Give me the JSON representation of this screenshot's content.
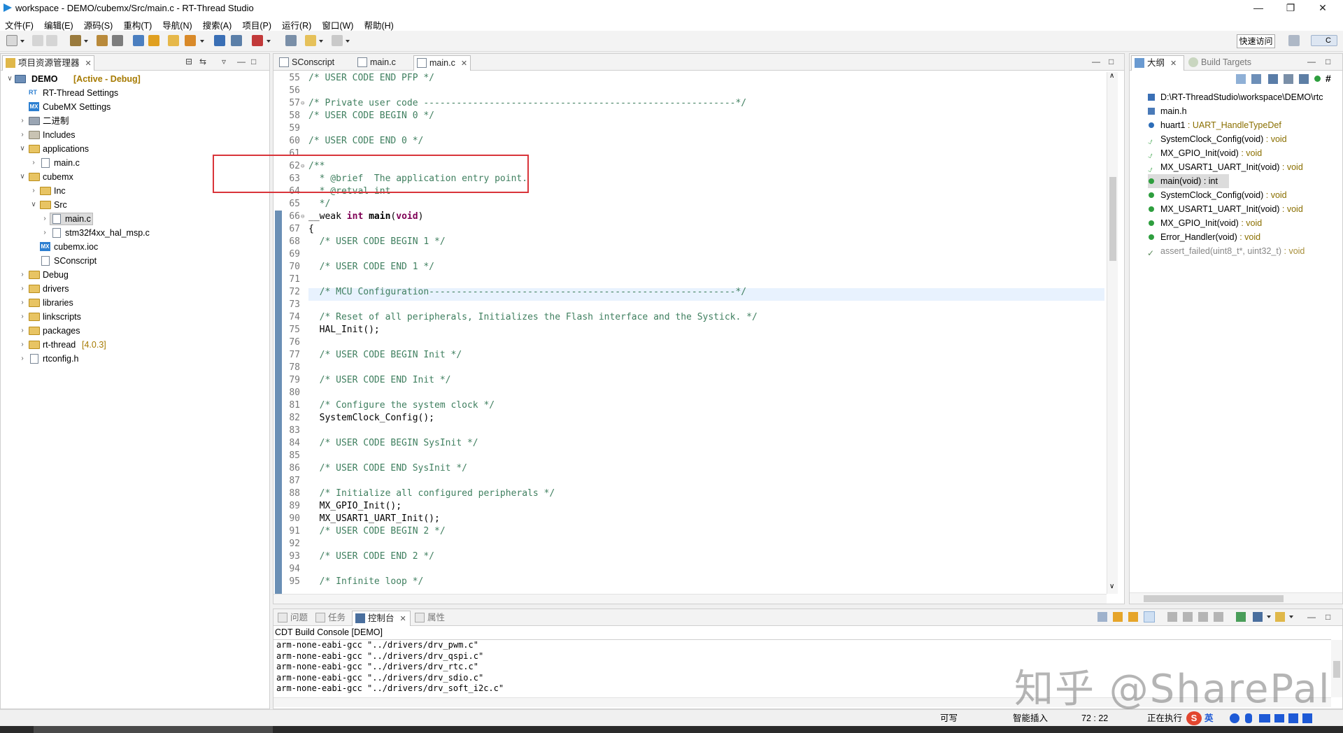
{
  "window": {
    "title": "workspace - DEMO/cubemx/Src/main.c - RT-Thread Studio",
    "min_icon": "minimize-icon",
    "max_icon": "maximize-icon",
    "close_icon": "close-icon"
  },
  "menu": {
    "items": [
      "文件(F)",
      "编辑(E)",
      "源码(S)",
      "重构(T)",
      "导航(N)",
      "搜索(A)",
      "项目(P)",
      "运行(R)",
      "窗口(W)",
      "帮助(H)"
    ]
  },
  "toolbar": {
    "quick_access": "快速访问",
    "perspective": "C"
  },
  "explorer": {
    "title": "项目资源管理器",
    "project": "DEMO",
    "project_status": "[Active - Debug]",
    "items": [
      {
        "label": "RT-Thread Settings"
      },
      {
        "label": "CubeMX Settings"
      },
      {
        "label": "二进制"
      },
      {
        "label": "Includes"
      },
      {
        "label": "applications"
      },
      {
        "label": "main.c"
      },
      {
        "label": "cubemx"
      },
      {
        "label": "Inc"
      },
      {
        "label": "Src"
      },
      {
        "label": "main.c"
      },
      {
        "label": "stm32f4xx_hal_msp.c"
      },
      {
        "label": "cubemx.ioc"
      },
      {
        "label": "SConscript"
      },
      {
        "label": "Debug"
      },
      {
        "label": "drivers"
      },
      {
        "label": "libraries"
      },
      {
        "label": "linkscripts"
      },
      {
        "label": "packages"
      },
      {
        "label": "rt-thread"
      },
      {
        "label": "rtconfig.h"
      }
    ],
    "rtthread_version": "[4.0.3]"
  },
  "editor": {
    "tabs": [
      {
        "label": "SConscript"
      },
      {
        "label": "main.c"
      },
      {
        "label": "main.c"
      }
    ],
    "lines": [
      {
        "n": "55",
        "t": "/* USER CODE END PFP */"
      },
      {
        "n": "56",
        "t": ""
      },
      {
        "n": "57",
        "t": "/* Private user code ---------------------------------------------------------*/"
      },
      {
        "n": "58",
        "t": "/* USER CODE BEGIN 0 */"
      },
      {
        "n": "59",
        "t": ""
      },
      {
        "n": "60",
        "t": "/* USER CODE END 0 */"
      },
      {
        "n": "61",
        "t": ""
      },
      {
        "n": "62",
        "t": "/**"
      },
      {
        "n": "63",
        "t": "  * @brief  The application entry point."
      },
      {
        "n": "64",
        "t": "  * @retval int"
      },
      {
        "n": "65",
        "t": "  */"
      },
      {
        "n": "66",
        "t": "__weak int main(void)"
      },
      {
        "n": "67",
        "t": "{"
      },
      {
        "n": "68",
        "t": "  /* USER CODE BEGIN 1 */"
      },
      {
        "n": "69",
        "t": ""
      },
      {
        "n": "70",
        "t": "  /* USER CODE END 1 */"
      },
      {
        "n": "71",
        "t": ""
      },
      {
        "n": "72",
        "t": "  /* MCU Configuration--------------------------------------------------------*/"
      },
      {
        "n": "73",
        "t": ""
      },
      {
        "n": "74",
        "t": "  /* Reset of all peripherals, Initializes the Flash interface and the Systick. */"
      },
      {
        "n": "75",
        "t": "  HAL_Init();"
      },
      {
        "n": "76",
        "t": ""
      },
      {
        "n": "77",
        "t": "  /* USER CODE BEGIN Init */"
      },
      {
        "n": "78",
        "t": ""
      },
      {
        "n": "79",
        "t": "  /* USER CODE END Init */"
      },
      {
        "n": "80",
        "t": ""
      },
      {
        "n": "81",
        "t": "  /* Configure the system clock */"
      },
      {
        "n": "82",
        "t": "  SystemClock_Config();"
      },
      {
        "n": "83",
        "t": ""
      },
      {
        "n": "84",
        "t": "  /* USER CODE BEGIN SysInit */"
      },
      {
        "n": "85",
        "t": ""
      },
      {
        "n": "86",
        "t": "  /* USER CODE END SysInit */"
      },
      {
        "n": "87",
        "t": ""
      },
      {
        "n": "88",
        "t": "  /* Initialize all configured peripherals */"
      },
      {
        "n": "89",
        "t": "  MX_GPIO_Init();"
      },
      {
        "n": "90",
        "t": "  MX_USART1_UART_Init();"
      },
      {
        "n": "91",
        "t": "  /* USER CODE BEGIN 2 */"
      },
      {
        "n": "92",
        "t": ""
      },
      {
        "n": "93",
        "t": "  /* USER CODE END 2 */"
      },
      {
        "n": "94",
        "t": ""
      },
      {
        "n": "95",
        "t": "  /* Infinite loop */"
      }
    ]
  },
  "outline": {
    "tab_outline": "大纲",
    "tab_build": "Build Targets",
    "items": [
      {
        "name": "D:\\RT-ThreadStudio\\workspace\\DEMO\\rtc",
        "type": ""
      },
      {
        "name": "main.h",
        "type": ""
      },
      {
        "name": "huart1",
        "type": " : UART_HandleTypeDef"
      },
      {
        "name": "SystemClock_Config(void)",
        "type": " : void"
      },
      {
        "name": "MX_GPIO_Init(void)",
        "type": " : void"
      },
      {
        "name": "MX_USART1_UART_Init(void)",
        "type": " : void"
      },
      {
        "name": "main(void) : int",
        "type": ""
      },
      {
        "name": "SystemClock_Config(void)",
        "type": " : void"
      },
      {
        "name": "MX_USART1_UART_Init(void)",
        "type": " : void"
      },
      {
        "name": "MX_GPIO_Init(void)",
        "type": " : void"
      },
      {
        "name": "Error_Handler(void)",
        "type": " : void"
      },
      {
        "name": "assert_failed(uint8_t*, uint32_t)",
        "type": " : void"
      }
    ]
  },
  "bottom": {
    "tabs": [
      {
        "label": "问题"
      },
      {
        "label": "任务"
      },
      {
        "label": "控制台"
      },
      {
        "label": "属性"
      }
    ],
    "console_title": "CDT Build Console [DEMO]",
    "console_lines": [
      "arm-none-eabi-gcc \"../drivers/drv_pwm.c\"",
      "arm-none-eabi-gcc \"../drivers/drv_qspi.c\"",
      "arm-none-eabi-gcc \"../drivers/drv_rtc.c\"",
      "arm-none-eabi-gcc \"../drivers/drv_sdio.c\"",
      "arm-none-eabi-gcc \"../drivers/drv_soft_i2c.c\""
    ]
  },
  "status": {
    "writable": "可写",
    "insert_mode": "智能插入",
    "position": "72 : 22",
    "running": "正在执行",
    "ime_lang": "英"
  },
  "watermark": "知乎 @SharePal",
  "colors": {
    "accent": "#2c7fd1",
    "highlight_box": "#d9343a",
    "comment": "#3f7f5f",
    "keyword": "#7f0055"
  }
}
